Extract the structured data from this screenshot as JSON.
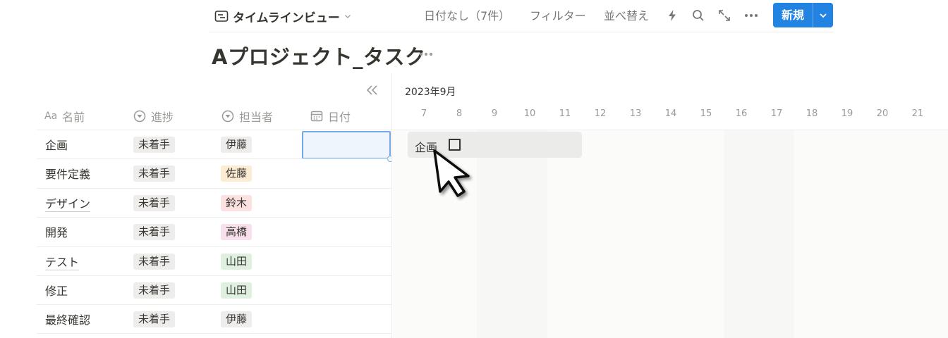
{
  "toolbar": {
    "view_name": "タイムラインビュー",
    "no_date": "日付なし（7件）",
    "filter": "フィルター",
    "sort": "並べ替え",
    "new_button": "新規",
    "icons": [
      "database-view-icon",
      "chevron-down-icon",
      "lightning-icon",
      "search-icon",
      "expand-icon",
      "more-icon"
    ]
  },
  "page": {
    "title": "Aプロジェクト_タスク"
  },
  "table": {
    "columns": {
      "name": "名前",
      "name_prefix": "Aa",
      "status": "進捗",
      "assignee": "担当者",
      "date": "日付"
    },
    "rows": [
      {
        "name": "企画",
        "status": "未着手",
        "assignee": "伊藤",
        "assignee_color": "#eeedeb"
      },
      {
        "name": "要件定義",
        "status": "未着手",
        "assignee": "佐藤",
        "assignee_color": "#fbecd3"
      },
      {
        "name": "デザイン",
        "status": "未着手",
        "assignee": "鈴木",
        "assignee_color": "#fbe1e0"
      },
      {
        "name": "開発",
        "status": "未着手",
        "assignee": "高橋",
        "assignee_color": "#f7e0ec"
      },
      {
        "name": "テスト",
        "status": "未着手",
        "assignee": "山田",
        "assignee_color": "#dff0e1"
      },
      {
        "name": "修正",
        "status": "未着手",
        "assignee": "山田",
        "assignee_color": "#dff0e1"
      },
      {
        "name": "最終確認",
        "status": "未着手",
        "assignee": "伊藤",
        "assignee_color": "#eeedeb"
      }
    ]
  },
  "timeline": {
    "month": "2023年9月",
    "days": [
      "7",
      "8",
      "9",
      "10",
      "11",
      "12",
      "13",
      "14",
      "15",
      "16",
      "17",
      "18",
      "19",
      "20",
      "21"
    ],
    "bar": {
      "label": "企画"
    }
  },
  "colors": {
    "accent": "#2383e2",
    "text": "#37352f",
    "muted": "#9b9a97",
    "border": "#ededec"
  }
}
